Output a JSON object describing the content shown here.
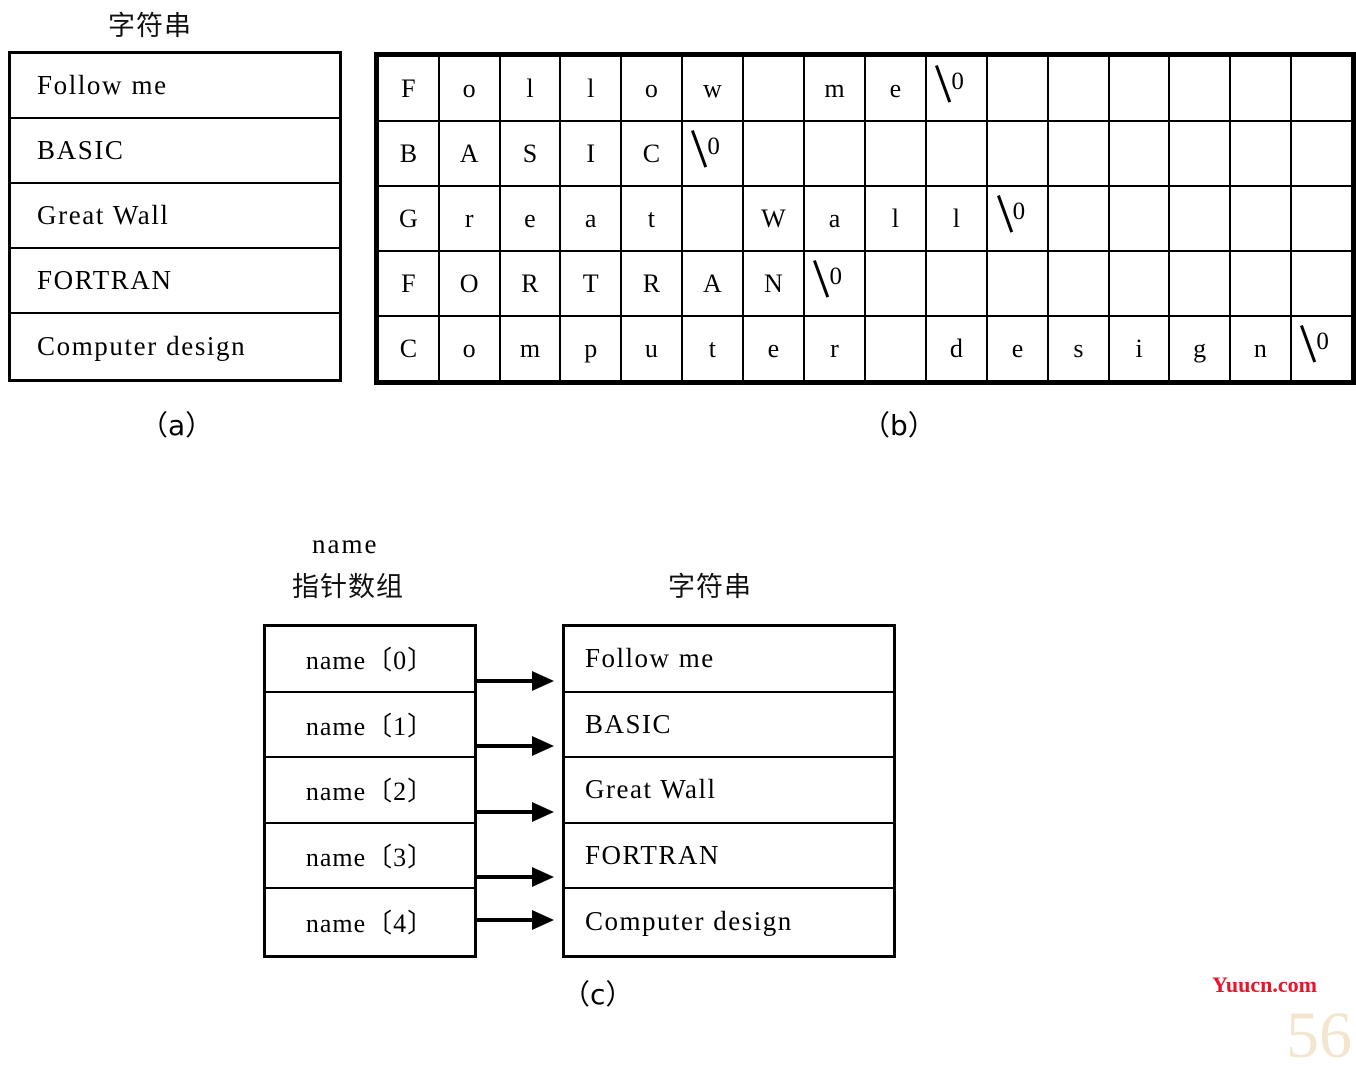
{
  "figure": {
    "captions": {
      "a": "（a）",
      "b": "（b）",
      "c": "（c）"
    }
  },
  "part_a": {
    "heading": "字符串",
    "rows": [
      "Follow me",
      "BASIC",
      "Great Wall",
      "FORTRAN",
      "Computer design"
    ]
  },
  "part_b": {
    "columns": 16,
    "null_glyph": "\\0",
    "null_zero": "0",
    "rows": [
      [
        "F",
        "o",
        "l",
        "l",
        "o",
        "w",
        " ",
        "m",
        "e",
        "\\0",
        "",
        "",
        "",
        "",
        "",
        ""
      ],
      [
        "B",
        "A",
        "S",
        "I",
        "C",
        "\\0",
        "",
        "",
        "",
        "",
        "",
        "",
        "",
        "",
        "",
        ""
      ],
      [
        "G",
        "r",
        "e",
        "a",
        "t",
        " ",
        "W",
        "a",
        "l",
        "l",
        "\\0",
        "",
        "",
        "",
        "",
        ""
      ],
      [
        "F",
        "O",
        "R",
        "T",
        "R",
        "A",
        "N",
        "\\0",
        "",
        "",
        "",
        "",
        "",
        "",
        "",
        ""
      ],
      [
        "C",
        "o",
        "m",
        "p",
        "u",
        "t",
        "e",
        "r",
        " ",
        "d",
        "e",
        "s",
        "i",
        "g",
        "n",
        "\\0"
      ]
    ]
  },
  "part_c": {
    "name_label": "name",
    "pointer_array_heading": "指针数组",
    "strings_heading": "字符串",
    "pointer_rows": [
      "name〔0〕",
      "name〔1〕",
      "name〔2〕",
      "name〔3〕",
      "name〔4〕"
    ],
    "string_rows": [
      "Follow me",
      "BASIC",
      "Great Wall",
      "FORTRAN",
      "Computer design"
    ]
  },
  "watermark": {
    "site": "Yuucn.com",
    "page_number": "56"
  }
}
